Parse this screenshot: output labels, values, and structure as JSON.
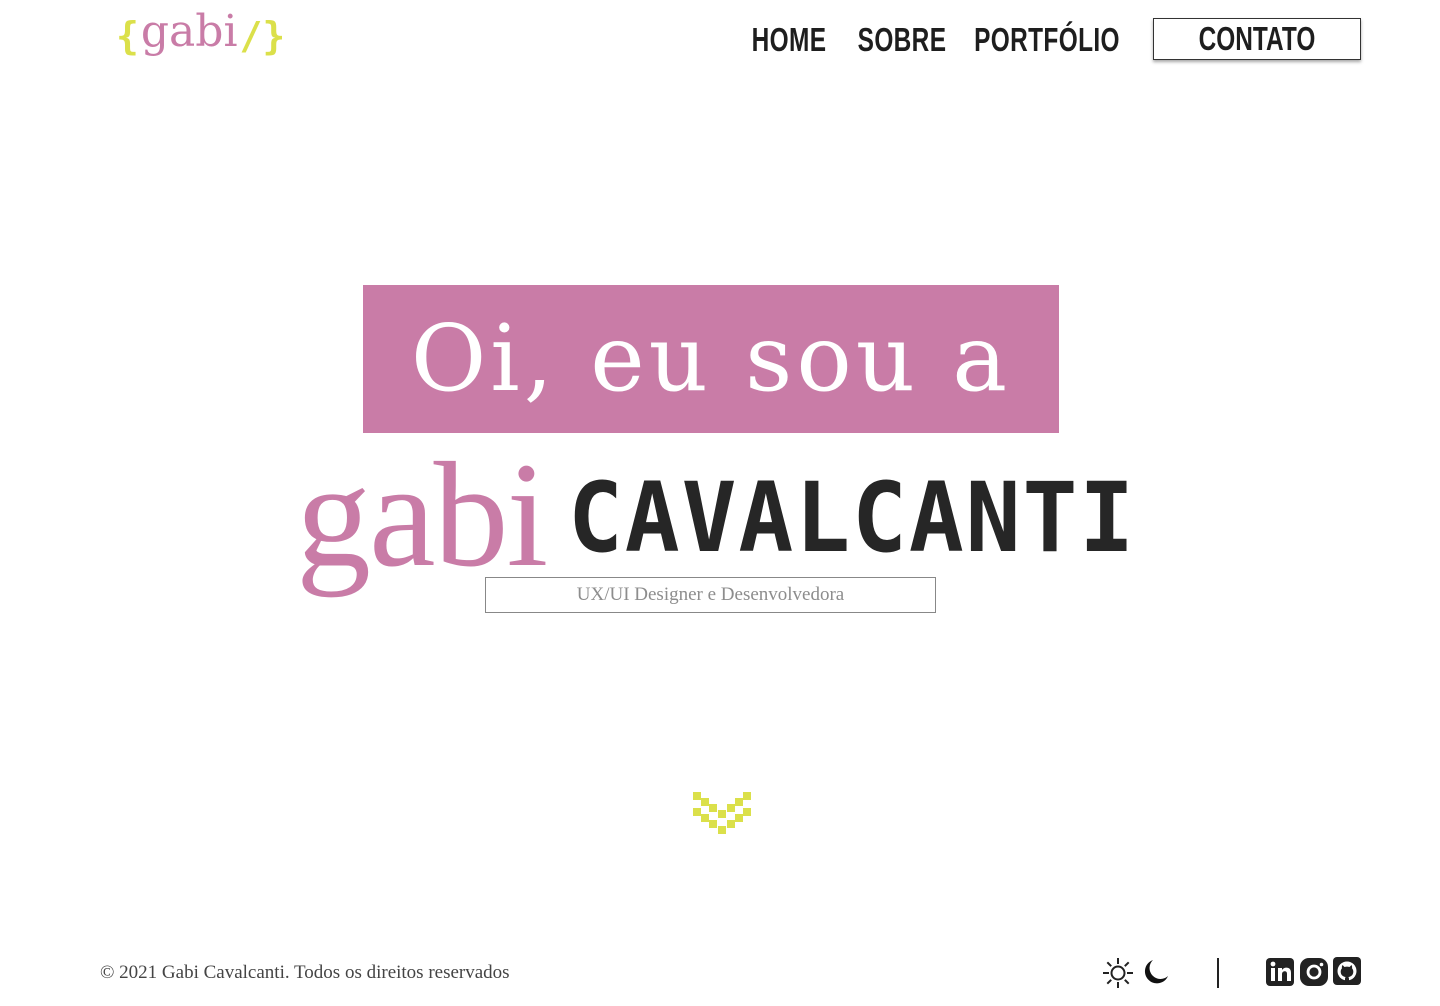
{
  "header": {
    "logo": {
      "open": "{",
      "word": "gabi",
      "close": "/}"
    },
    "nav": [
      {
        "label": "HOME"
      },
      {
        "label": "SOBRE"
      },
      {
        "label": "PORTFÓLIO"
      }
    ],
    "contact_label": "CONTATO"
  },
  "hero": {
    "greeting": "Oi, eu sou a",
    "first_name": "gabi",
    "last_name": "CAVALCANTI",
    "subtitle": "UX/UI Designer e Desenvolvedora"
  },
  "icons": {
    "scroll": "chevron-down-icon",
    "theme_light": "sun-icon",
    "theme_dark": "moon-icon",
    "social": [
      "linkedin-icon",
      "instagram-icon",
      "github-icon"
    ]
  },
  "footer": {
    "copyright": "© 2021 Gabi Cavalcanti. Todos os direitos reservados"
  },
  "colors": {
    "pink": "#c97ca7",
    "lime": "#dbe04a",
    "dark": "#222222"
  }
}
